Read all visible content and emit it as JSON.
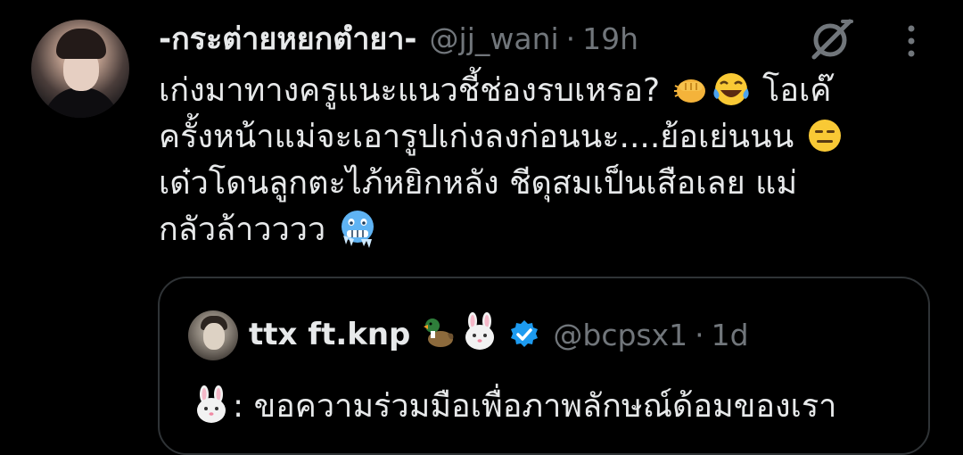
{
  "tweet": {
    "display_name": "-กระต่ายหยกตำยา-",
    "handle": "@jj_wani",
    "separator": "·",
    "time": "19h",
    "text_lines": [
      {
        "before": "เก่งมาทางครูแนะแนวชี้ช่องรบเหรอ? ",
        "emojis": [
          "fist-emoji",
          "laughing-tears-emoji"
        ],
        "after": " โอเค๊"
      },
      {
        "before": "ครั้งหน้าแม่จะเอารูปเก่งลงก่อนนะ....ย้อเย่นนน ",
        "emojis": [
          "expressionless-face-emoji"
        ],
        "after": ""
      },
      {
        "before": "เด๋วโดนลูกตะไภ้หยิกหลัง ชีดุสมเป็นเสือเลย แม่",
        "emojis": [],
        "after": ""
      },
      {
        "before": "กลัวล้าวววว ",
        "emojis": [
          "cold-face-emoji"
        ],
        "after": ""
      }
    ]
  },
  "quote": {
    "display_name": "ttx ft.knp",
    "name_emojis": [
      "duck-emoji",
      "rabbit-face-emoji"
    ],
    "verified_icon": "verified-badge-icon",
    "handle": "@bcpsx1",
    "separator": "·",
    "time": "1d",
    "text_emoji": "rabbit-face-emoji",
    "text": ": ขอความร่วมมือเพื่อภาพลักษณ์ด้อมของเรา"
  },
  "icons": {
    "grok": "grok-icon",
    "more": "more-options-icon"
  },
  "colors": {
    "background": "#000000",
    "primary_text": "#e7e9ea",
    "secondary_text": "#71767b",
    "border": "#2f3336",
    "verified": "#1d9bf0"
  }
}
